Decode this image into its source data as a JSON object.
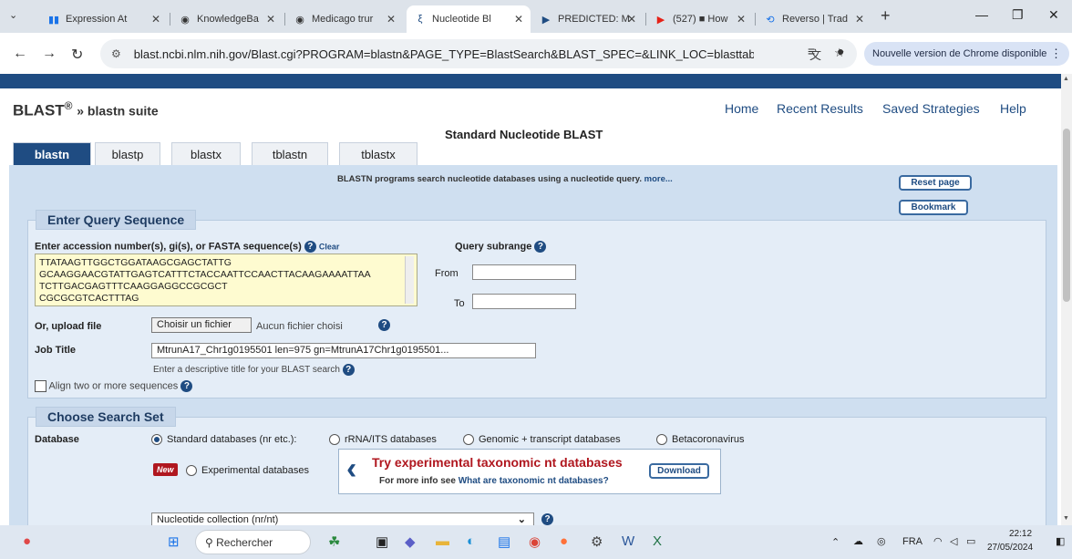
{
  "tabs": [
    {
      "label": "Expression At",
      "icon": "bar-chart-icon",
      "color": "#1a73e8"
    },
    {
      "label": "KnowledgeBa",
      "icon": "globe-icon",
      "color": "#555555"
    },
    {
      "label": "Medicago trur",
      "icon": "globe-icon",
      "color": "#555555"
    },
    {
      "label": "Nucleotide Bl",
      "icon": "ncbi-icon",
      "color": "#1f4c82"
    },
    {
      "label": "PREDICTED: M",
      "icon": "play-arrow-icon",
      "color": "#1f4c82"
    },
    {
      "label": "(527) ■ How",
      "icon": "youtube-icon",
      "color": "#e62117"
    },
    {
      "label": "Reverso | Trad",
      "icon": "reverso-icon",
      "color": "#1a73e8"
    }
  ],
  "new_tab": "+",
  "window": {
    "minimize": "—",
    "restore": "❐",
    "close": "✕"
  },
  "address": {
    "url": "blast.ncbi.nlm.nih.gov/Blast.cgi?PROGRAM=blastn&PAGE_TYPE=BlastSearch&BLAST_SPEC=&LINK_LOC=blasttab...",
    "update_button": "Nouvelle version de Chrome disponible"
  },
  "site": {
    "brand": "BLAST",
    "brand_reg": "®",
    "brand_suffix": "» blastn suite",
    "links": [
      "Home",
      "Recent Results",
      "Saved Strategies",
      "Help"
    ],
    "page_title": "Standard Nucleotide BLAST",
    "program_tabs": [
      "blastn",
      "blastp",
      "blastx",
      "tblastn",
      "tblastx"
    ],
    "description": "BLASTN programs search nucleotide databases using a nucleotide query.",
    "description_more": "more...",
    "reset_button": "Reset page",
    "bookmark_button": "Bookmark"
  },
  "query": {
    "heading": "Enter Query Sequence",
    "seq_label": "Enter accession number(s), gi(s), or FASTA sequence(s)",
    "clear": "Clear",
    "sequence_lines": [
      "TTATAAGTTGGCTGGATAAGCGAGCTATTG",
      "GCAAGGAACGTATTGAGTCATTTCTACCAATTCCAACTTACAAGAAAATTAA",
      "TCTTGACGAGTTTCAAGGAGGCCGCGCT",
      "CGCGCGTCACTTTAG"
    ],
    "subrange_label": "Query subrange",
    "from_label": "From",
    "to_label": "To",
    "upload_label": "Or, upload file",
    "choose_file": "Choisir un fichier",
    "no_file": "Aucun fichier choisi",
    "job_title_label": "Job Title",
    "job_title_value": "MtrunA17_Chr1g0195501 len=975 gn=MtrunA17Chr1g0195501...",
    "job_title_hint": "Enter a descriptive title for your BLAST search",
    "align_label": "Align two or more sequences"
  },
  "search_set": {
    "heading": "Choose Search Set",
    "database_label": "Database",
    "options": [
      "Standard databases (nr etc.):",
      "rRNA/ITS databases",
      "Genomic + transcript databases",
      "Betacoronavirus"
    ],
    "new_badge": "New",
    "experimental": "Experimental databases",
    "try_title": "Try experimental taxonomic nt databases",
    "try_info": "For more info see",
    "try_link": "What are taxonomic nt databases?",
    "download_button": "Download",
    "collection_value": "Nucleotide collection (nr/nt)"
  },
  "taskbar": {
    "search_placeholder": "Rechercher",
    "lang": "FRA",
    "time": "22:12",
    "date": "27/05/2024"
  }
}
